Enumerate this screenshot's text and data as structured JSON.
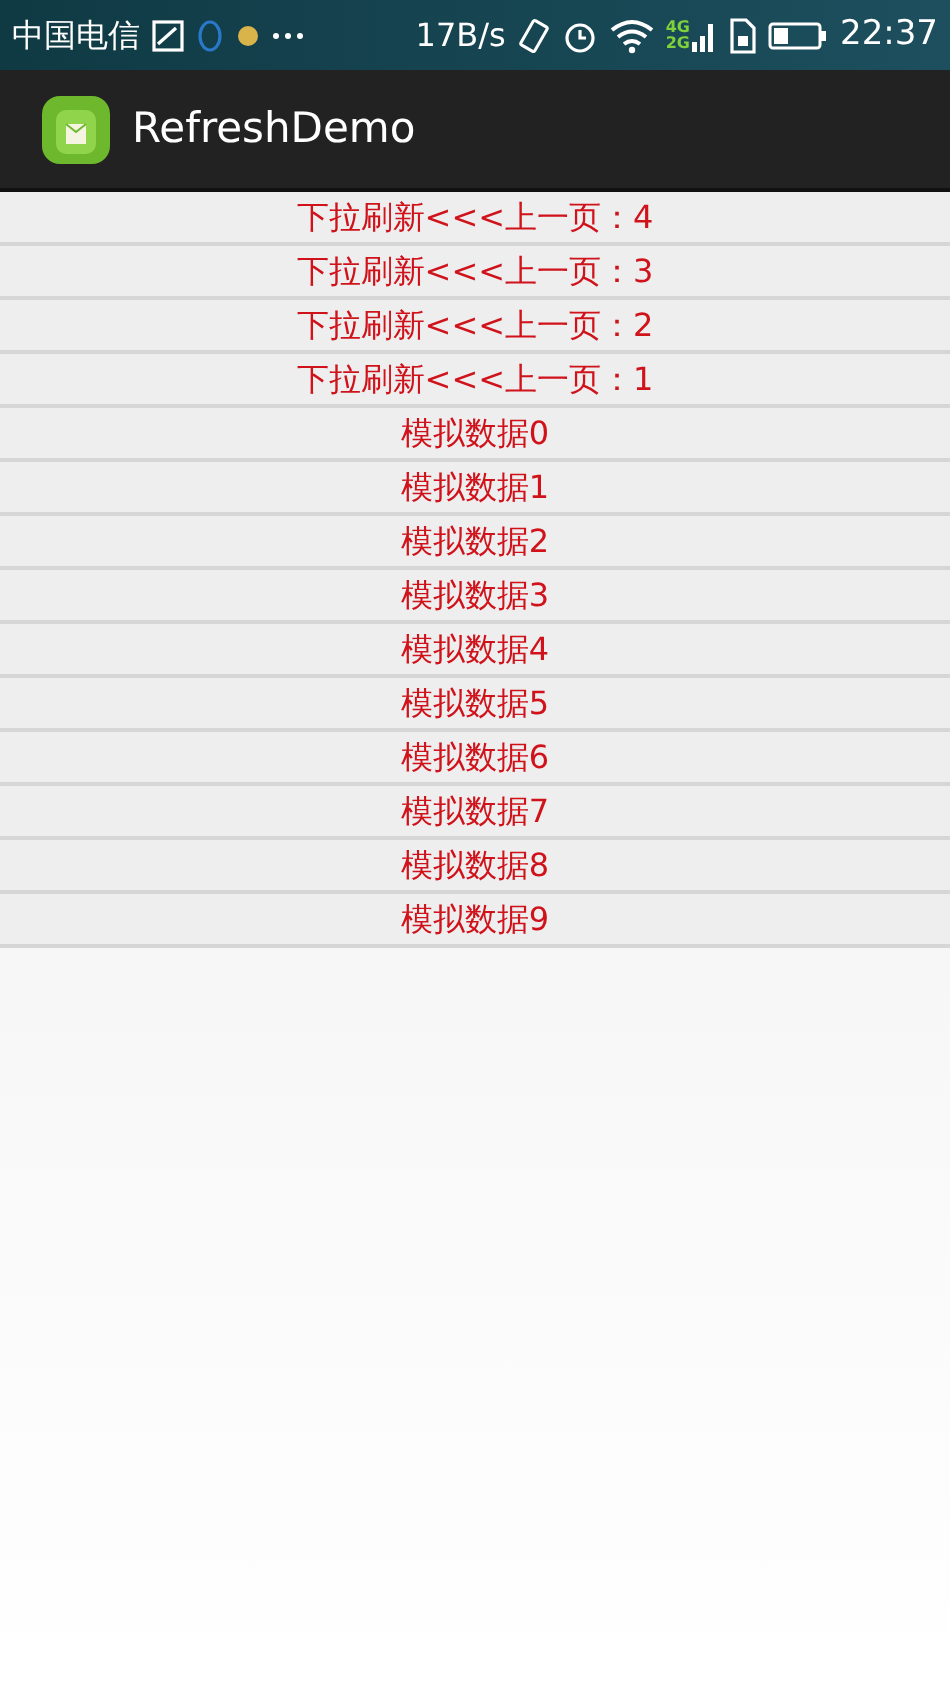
{
  "status_bar": {
    "carrier": "中国电信",
    "speed": "17B/s",
    "network": [
      "4G",
      "2G"
    ],
    "time": "22:37"
  },
  "app_bar": {
    "title": "RefreshDemo"
  },
  "list": {
    "items": [
      {
        "label": "下拉刷新<<<上一页：4"
      },
      {
        "label": "下拉刷新<<<上一页：3"
      },
      {
        "label": "下拉刷新<<<上一页：2"
      },
      {
        "label": "下拉刷新<<<上一页：1"
      },
      {
        "label": "模拟数据0"
      },
      {
        "label": "模拟数据1"
      },
      {
        "label": "模拟数据2"
      },
      {
        "label": "模拟数据3"
      },
      {
        "label": "模拟数据4"
      },
      {
        "label": "模拟数据5"
      },
      {
        "label": "模拟数据6"
      },
      {
        "label": "模拟数据7"
      },
      {
        "label": "模拟数据8"
      },
      {
        "label": "模拟数据9"
      }
    ]
  }
}
